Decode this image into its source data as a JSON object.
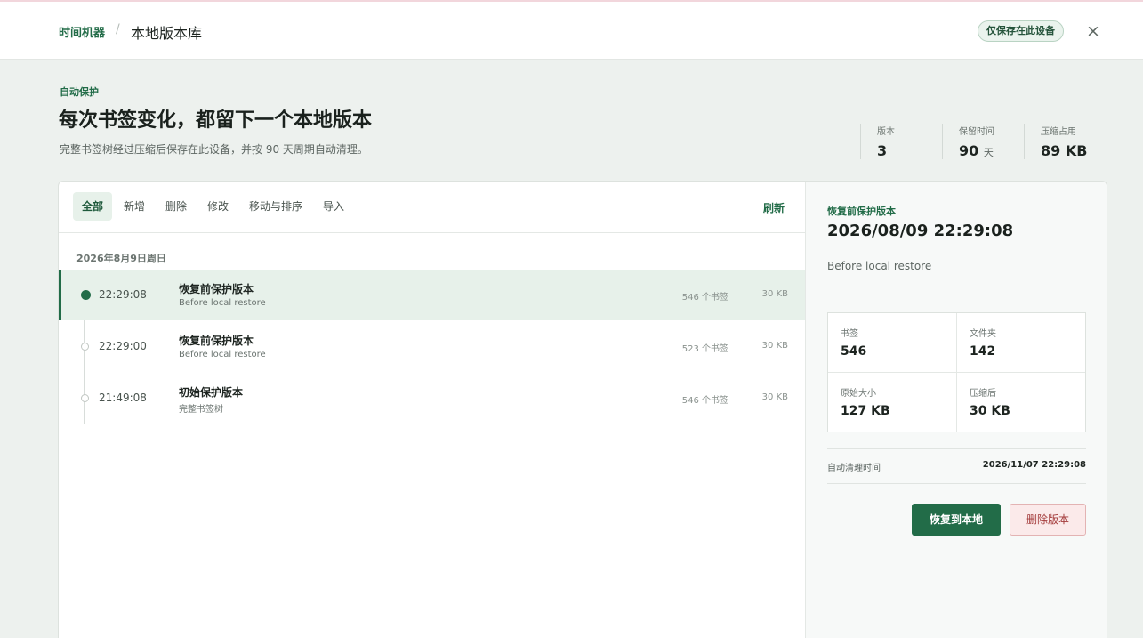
{
  "breadcrumb": {
    "parent": "时间机器",
    "separator": "/",
    "current": "本地版本库"
  },
  "header": {
    "badge": "仅保存在此设备",
    "close_icon": "×"
  },
  "intro": {
    "eyebrow": "自动保护",
    "title": "每次书签变化，都留下一个本地版本",
    "description": "完整书签树经过压缩后保存在此设备，并按 90 天周期自动清理。"
  },
  "stats": [
    {
      "label": "版本",
      "value": "3",
      "unit": ""
    },
    {
      "label": "保留时间",
      "value": "90",
      "unit": "天"
    },
    {
      "label": "压缩占用",
      "value": "89 KB",
      "unit": ""
    }
  ],
  "tabs": [
    {
      "label": "全部",
      "active": true
    },
    {
      "label": "新增",
      "active": false
    },
    {
      "label": "删除",
      "active": false
    },
    {
      "label": "修改",
      "active": false
    },
    {
      "label": "移动与排序",
      "active": false
    },
    {
      "label": "导入",
      "active": false
    }
  ],
  "refresh_label": "刷新",
  "date_group": "2026年8月9日周日",
  "versions": [
    {
      "time": "22:29:08",
      "title": "恢复前保护版本",
      "subtitle": "Before local restore",
      "count": "546 个书签",
      "size": "30 KB",
      "selected": true
    },
    {
      "time": "22:29:00",
      "title": "恢复前保护版本",
      "subtitle": "Before local restore",
      "count": "523 个书签",
      "size": "30 KB",
      "selected": false
    },
    {
      "time": "21:49:08",
      "title": "初始保护版本",
      "subtitle": "完整书签树",
      "count": "546 个书签",
      "size": "30 KB",
      "selected": false
    }
  ],
  "detail": {
    "eyebrow": "恢复前保护版本",
    "title": "2026/08/09 22:29:08",
    "subtitle": "Before local restore",
    "cells": [
      {
        "label": "书签",
        "value": "546"
      },
      {
        "label": "文件夹",
        "value": "142"
      },
      {
        "label": "原始大小",
        "value": "127 KB"
      },
      {
        "label": "压缩后",
        "value": "30 KB"
      }
    ],
    "clean_label": "自动清理时间",
    "clean_value": "2026/11/07 22:29:08",
    "restore_button": "恢复到本地",
    "delete_button": "删除版本"
  }
}
